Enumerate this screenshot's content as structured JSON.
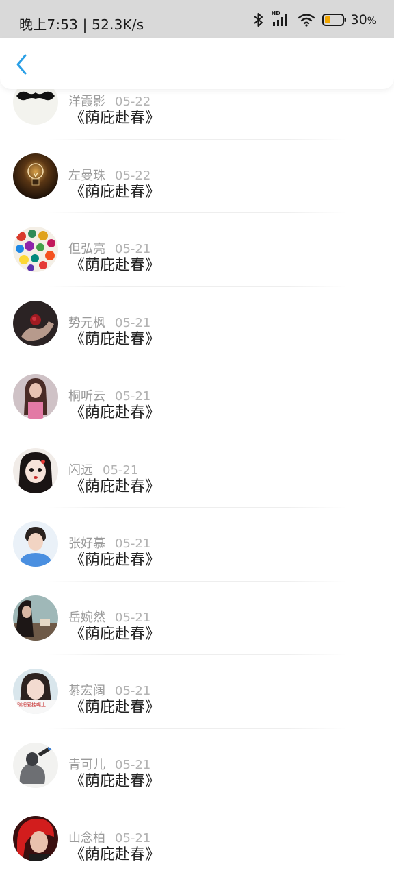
{
  "status_bar": {
    "time_speed": "晚上7:53 | 52.3K/s",
    "network_badge": "HD",
    "battery": "30",
    "battery_unit": "%"
  },
  "header": {
    "back_icon": "chevron-left-icon",
    "accent_color": "#2a9fe6"
  },
  "comments": [
    {
      "name": "洋霞影",
      "date": "05-22",
      "text": "《荫庇赴春》",
      "avatar": "mustache"
    },
    {
      "name": "左曼珠",
      "date": "05-22",
      "text": "《荫庇赴春》",
      "avatar": "lightbulb"
    },
    {
      "name": "但弘亮",
      "date": "05-21",
      "text": "《荫庇赴春》",
      "avatar": "colorful-crowd"
    },
    {
      "name": "势元枫",
      "date": "05-21",
      "text": "《荫庇赴春》",
      "avatar": "hand-rose"
    },
    {
      "name": "桐听云",
      "date": "05-21",
      "text": "《荫庇赴春》",
      "avatar": "girl-pink"
    },
    {
      "name": "闪远",
      "date": "05-21",
      "text": "《荫庇赴春》",
      "avatar": "cartoon-girl"
    },
    {
      "name": "张好慕",
      "date": "05-21",
      "text": "《荫庇赴春》",
      "avatar": "boy-blue"
    },
    {
      "name": "岳婉然",
      "date": "05-21",
      "text": "《荫庇赴春》",
      "avatar": "girl-dark"
    },
    {
      "name": "綦宏阔",
      "date": "05-21",
      "text": "《荫庇赴春》",
      "avatar": "girl-caption"
    },
    {
      "name": "青可儿",
      "date": "05-21",
      "text": "《荫庇赴春》",
      "avatar": "sketch-character"
    },
    {
      "name": "山念柏",
      "date": "05-21",
      "text": "《荫庇赴春》",
      "avatar": "red-hair"
    }
  ],
  "avatar_caption": "别把爱挂嘴上"
}
